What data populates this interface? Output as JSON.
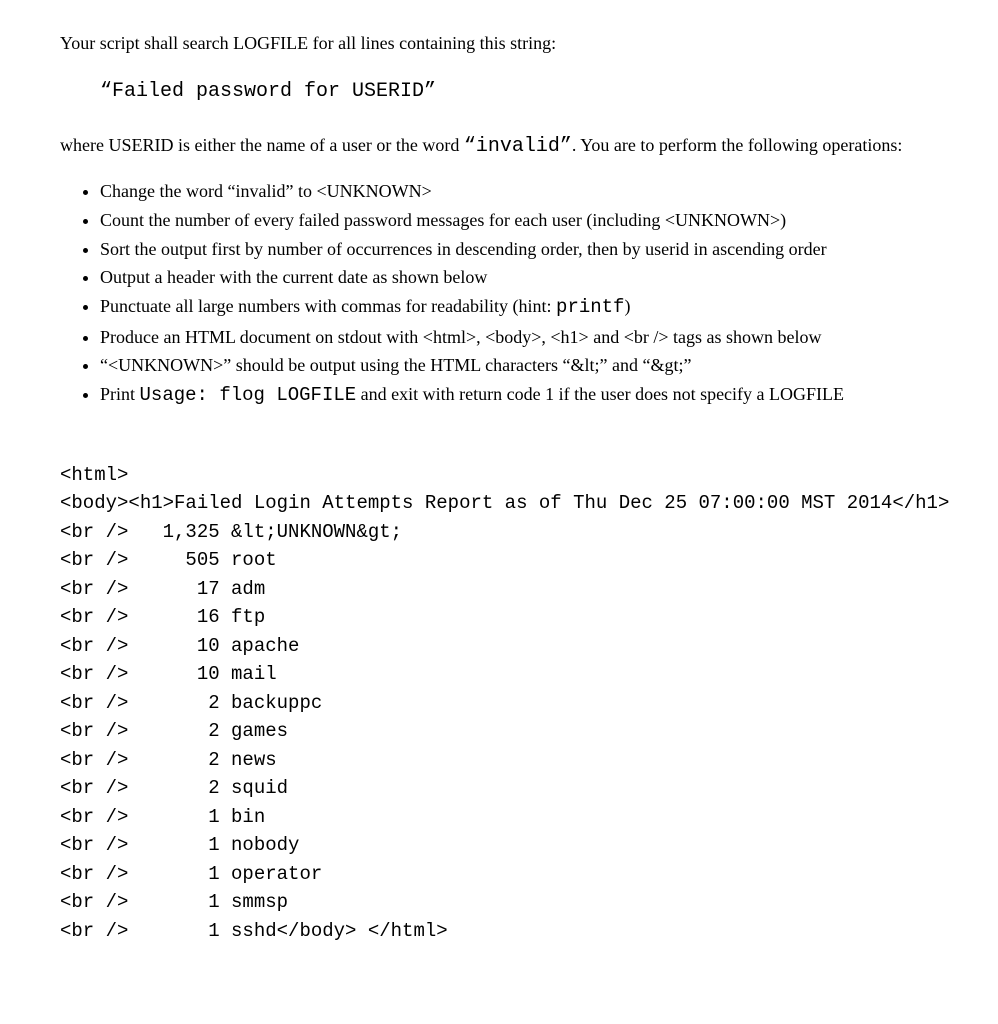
{
  "intro": "Your script shall search LOGFILE for all lines containing this string:",
  "searchString": "“Failed password for USERID”",
  "where_pre": "where USERID is either the name of a user or the word ",
  "where_mono": "“invalid”",
  "where_post": ".  You are to perform the following operations:",
  "ops": [
    {
      "text": "Change the word “invalid” to <UNKNOWN>"
    },
    {
      "text": "Count the number of every failed password messages for each user (including <UNKNOWN>)"
    },
    {
      "text": "Sort the output first by number of occurrences in descending order, then by userid in ascending order"
    },
    {
      "text": "Output a header with the current date as shown below"
    },
    {
      "pre": "Punctuate all large numbers with commas for readability (hint: ",
      "mono": "printf",
      "post": ")"
    },
    {
      "text": "Produce an HTML document on stdout with <html>,  <body>, <h1> and <br /> tags as shown below"
    },
    {
      "text": "“<UNKNOWN>” should be output using the HTML characters “&lt;” and “&gt;”"
    },
    {
      "pre": "Print ",
      "mono": "Usage: flog LOGFILE",
      "post": " and exit with return code 1 if the user does not specify a LOGFILE"
    }
  ],
  "output": "<html>\n<body><h1>Failed Login Attempts Report as of Thu Dec 25 07:00:00 MST 2014</h1>\n<br />   1,325 &lt;UNKNOWN&gt;\n<br />     505 root\n<br />      17 adm\n<br />      16 ftp\n<br />      10 apache\n<br />      10 mail\n<br />       2 backuppc\n<br />       2 games\n<br />       2 news\n<br />       2 squid\n<br />       1 bin\n<br />       1 nobody\n<br />       1 operator\n<br />       1 smmsp\n<br />       1 sshd</body> </html>"
}
